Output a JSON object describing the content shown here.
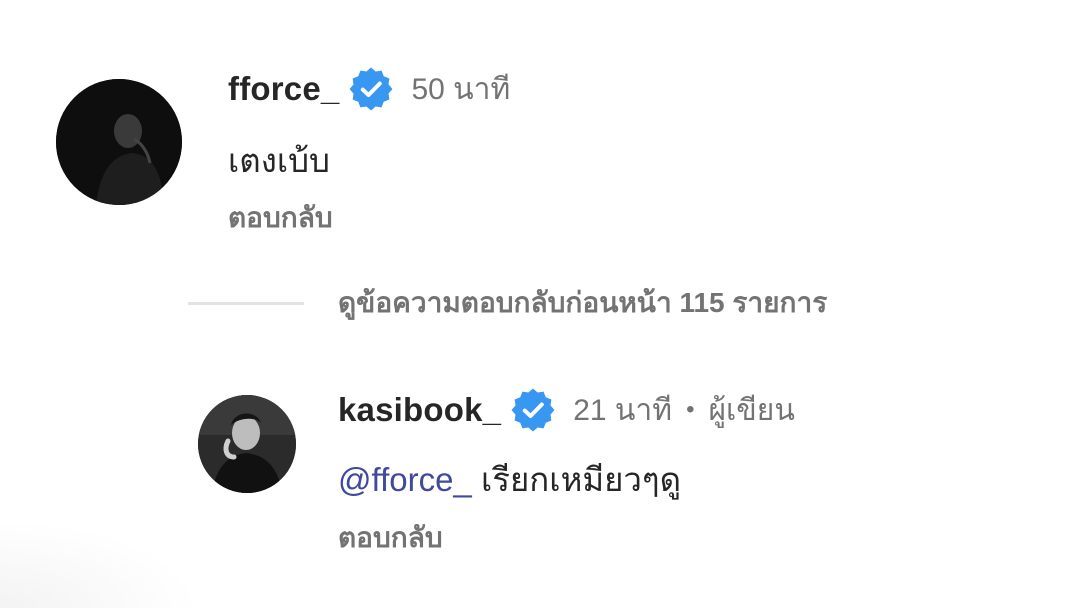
{
  "comments": [
    {
      "username": "fforce_",
      "verified_icon": "verified-badge-icon",
      "time": "50 นาที",
      "text": "เตงเบ้บ",
      "reply_label": "ตอบกลับ"
    }
  ],
  "view_previous_replies": {
    "label": "ดูข้อความตอบกลับก่อนหน้า 115 รายการ"
  },
  "replies": [
    {
      "username": "kasibook_",
      "verified_icon": "verified-badge-icon",
      "time": "21 นาที",
      "separator": "•",
      "author_badge": "ผู้เขียน",
      "mention": "@fforce_",
      "text": " เรียกเหมียวๆดู",
      "reply_label": "ตอบกลับ"
    }
  ],
  "colors": {
    "verified_blue": "#3897f0",
    "mention": "#3f4a9a",
    "secondary_text": "#737373",
    "primary_text": "#262626"
  }
}
